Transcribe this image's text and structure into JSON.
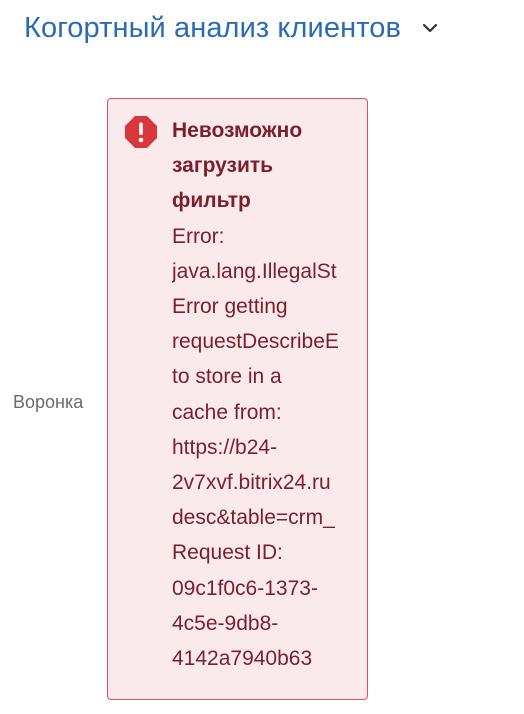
{
  "header": {
    "title": "Когортный анализ клиентов",
    "chevron_icon": "chevron-down-icon"
  },
  "colors": {
    "title": "#2a6bb3",
    "error_background": "#fbeaec",
    "error_border": "#e0505c",
    "error_text": "#7a1f2b",
    "error_icon": "#d9363e"
  },
  "filter": {
    "label": "Воронка",
    "error": {
      "icon": "error-exclamation-icon",
      "title": "Невозможно загрузить фильтр",
      "lines": [
        "Error:",
        "java.lang.IllegalSt",
        "Error getting",
        "requestDescribeE",
        "to store in a",
        "cache from:",
        "https://b24-",
        "2v7xvf.bitrix24.ru",
        "desc&table=crm_",
        "Request ID:",
        "09c1f0c6-1373-",
        "4c5e-9db8-",
        "4142a7940b63"
      ]
    }
  }
}
